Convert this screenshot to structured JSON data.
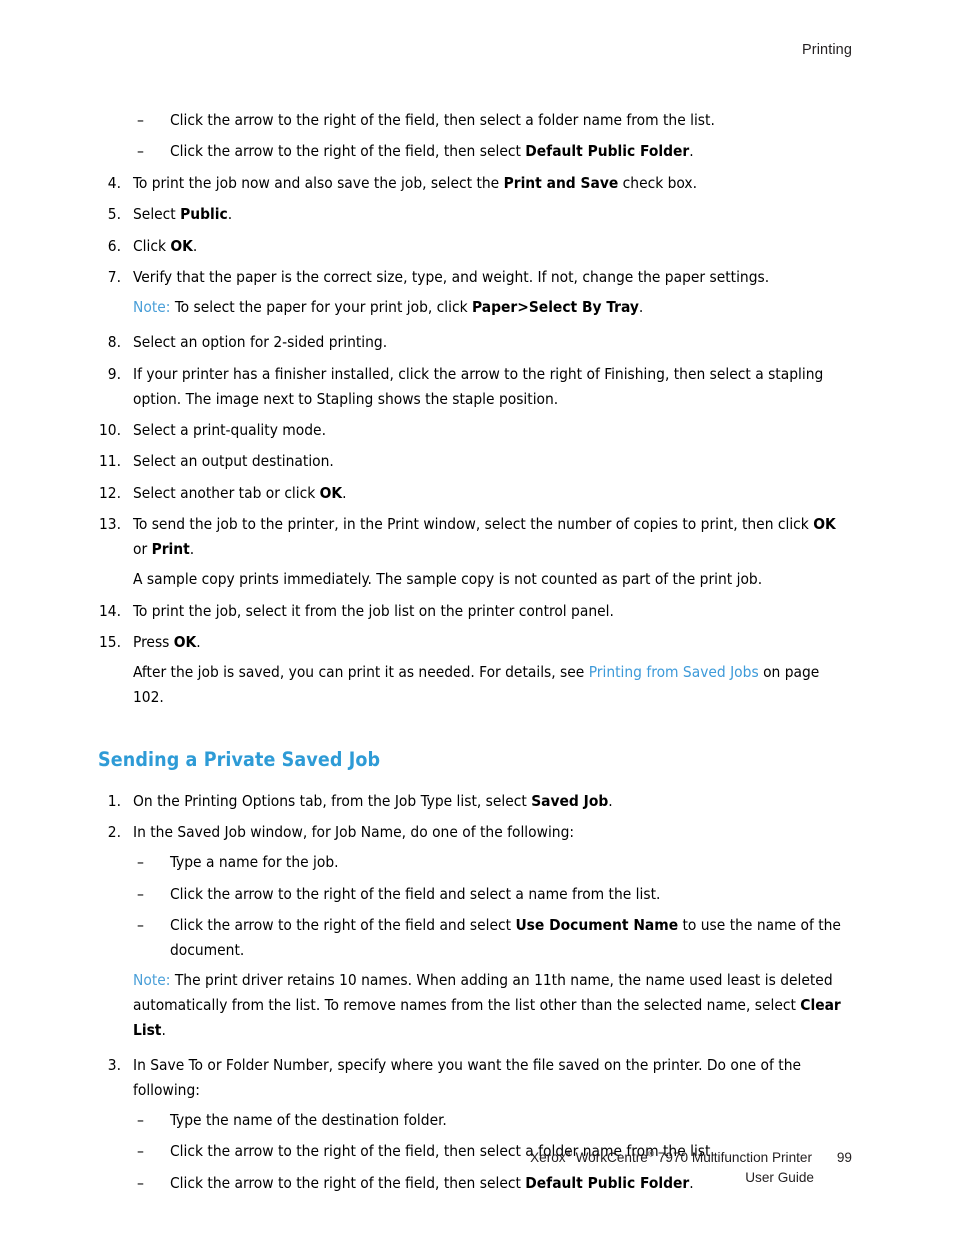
{
  "header": {
    "chapter_title": "Printing"
  },
  "body": {
    "top_dash_items": [
      "Click the arrow to the right of the field, then select a folder name from the list.",
      {
        "pre": "Click the arrow to the right of the field, then select ",
        "bold": "Default Public Folder",
        "post": "."
      }
    ],
    "steps": [
      {
        "num": "4.",
        "pre": "To print the job now and also save the job, select the ",
        "bold": "Print and Save",
        "post": " check box."
      },
      {
        "num": "5.",
        "pre": "Select ",
        "bold": "Public",
        "post": "."
      },
      {
        "num": "6.",
        "pre": "Click ",
        "bold": "OK",
        "post": "."
      },
      {
        "num": "7.",
        "pre": "Verify that the paper is the correct size, type, and weight. If not, change the paper settings.",
        "bold": "",
        "post": ""
      }
    ],
    "note1": {
      "label": "Note:",
      "pre": " To select the paper for your print job, click ",
      "bold": "Paper>Select By Tray",
      "post": "."
    },
    "steps2": [
      {
        "num": "8.",
        "pre": "Select an option for 2-sided printing.",
        "bold": "",
        "post": ""
      },
      {
        "num": "9.",
        "pre": "If your printer has a finisher installed, click the arrow to the right of Finishing, then select a stapling option. The image next to Stapling shows the staple position.",
        "bold": "",
        "post": ""
      },
      {
        "num": "10.",
        "pre": "Select a print-quality mode.",
        "bold": "",
        "post": ""
      },
      {
        "num": "11.",
        "pre": "Select an output destination.",
        "bold": "",
        "post": ""
      },
      {
        "num": "12.",
        "pre": "Select another tab or click ",
        "bold": "OK",
        "post": "."
      }
    ],
    "step13": {
      "num": "13.",
      "pre": "To send the job to the printer, in the Print window, select the number of copies to print, then click ",
      "bold1": "OK",
      "mid": " or ",
      "bold2": "Print",
      "post": "."
    },
    "step13_followup": "A sample copy prints immediately. The sample copy is not counted as part of the print job.",
    "step14": {
      "num": "14.",
      "text": "To print the job, select it from the job list on the printer control panel."
    },
    "step15": {
      "num": "15.",
      "pre": "Press ",
      "bold": "OK",
      "post": "."
    },
    "step15_followup": {
      "pre": "After the job is saved, you can print it as needed. For details, see ",
      "link": "Printing from Saved Jobs",
      "post": " on page 102."
    }
  },
  "section": {
    "heading": "Sending a Private Saved Job",
    "step1": {
      "num": "1.",
      "pre": "On the Printing Options tab, from the Job Type list, select ",
      "bold": "Saved Job",
      "post": "."
    },
    "step2": {
      "num": "2.",
      "text": "In the Saved Job window, for Job Name, do one of the following:"
    },
    "step2_dashes": [
      {
        "pre": "Type a name for the job.",
        "bold": "",
        "post": ""
      },
      {
        "pre": "Click the arrow to the right of the field and select a name from the list.",
        "bold": "",
        "post": ""
      },
      {
        "pre": "Click the arrow to the right of the field and select ",
        "bold": "Use Document Name",
        "post": " to use the name of the document."
      }
    ],
    "note2": {
      "label": "Note:",
      "pre": " The print driver retains 10 names. When adding an 11th name, the name used least is deleted automatically from the list. To remove names from the list other than the selected name, select ",
      "bold": "Clear List",
      "post": "."
    },
    "step3": {
      "num": "3.",
      "text": "In Save To or Folder Number, specify where you want the file saved on the printer. Do one of the following:"
    },
    "step3_dashes": [
      {
        "pre": "Type the name of the destination folder.",
        "bold": "",
        "post": ""
      },
      {
        "pre": "Click the arrow to the right of the field, then select a folder name from the list.",
        "bold": "",
        "post": ""
      },
      {
        "pre": "Click the arrow to the right of the field, then select ",
        "bold": "Default Public Folder",
        "post": "."
      }
    ]
  },
  "footer": {
    "product_pre": "Xerox",
    "reg1": "®",
    "product_mid": " WorkCentre",
    "reg2": "®",
    "product_post": " 7970 Multifunction Printer",
    "guide": "User Guide",
    "page_number": "99"
  },
  "colors": {
    "heading_blue": "#2e9bd6",
    "note_blue": "#4a9fd8",
    "xref_blue": "#3d9ad9",
    "text_black": "#000000"
  },
  "glyphs": {
    "dash": "–",
    "registered": "®"
  }
}
